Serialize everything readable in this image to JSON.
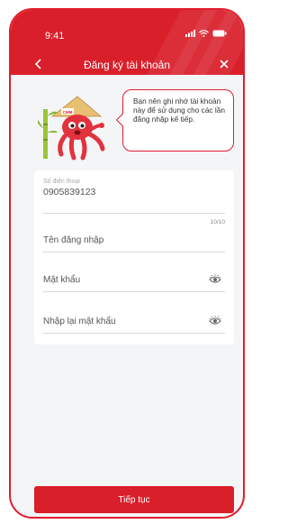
{
  "status_bar": {
    "time": "9:41"
  },
  "header": {
    "title": "Đăng ký tài khoản"
  },
  "bubble": {
    "text": "Bạn nên ghi nhớ tài khoản này để sử dụng cho các lần đăng nhập kế tiếp."
  },
  "mascot": {
    "logo": "CMM"
  },
  "form": {
    "phone": {
      "label": "Số điện thoại",
      "value": "0905839123",
      "counter": "10/10"
    },
    "username": {
      "placeholder": "Tên đăng nhập"
    },
    "password": {
      "placeholder": "Mật khẩu"
    },
    "confirm_password": {
      "placeholder": "Nhập lại mật khẩu"
    }
  },
  "cta": {
    "label": "Tiếp tục"
  },
  "colors": {
    "brand_red": "#d91f2a",
    "frame": "#e11d2c",
    "background": "#f4f5f7"
  },
  "icons": [
    "back-arrow-icon",
    "close-icon",
    "eye-icon",
    "signal-icon",
    "wifi-icon",
    "battery-icon"
  ]
}
